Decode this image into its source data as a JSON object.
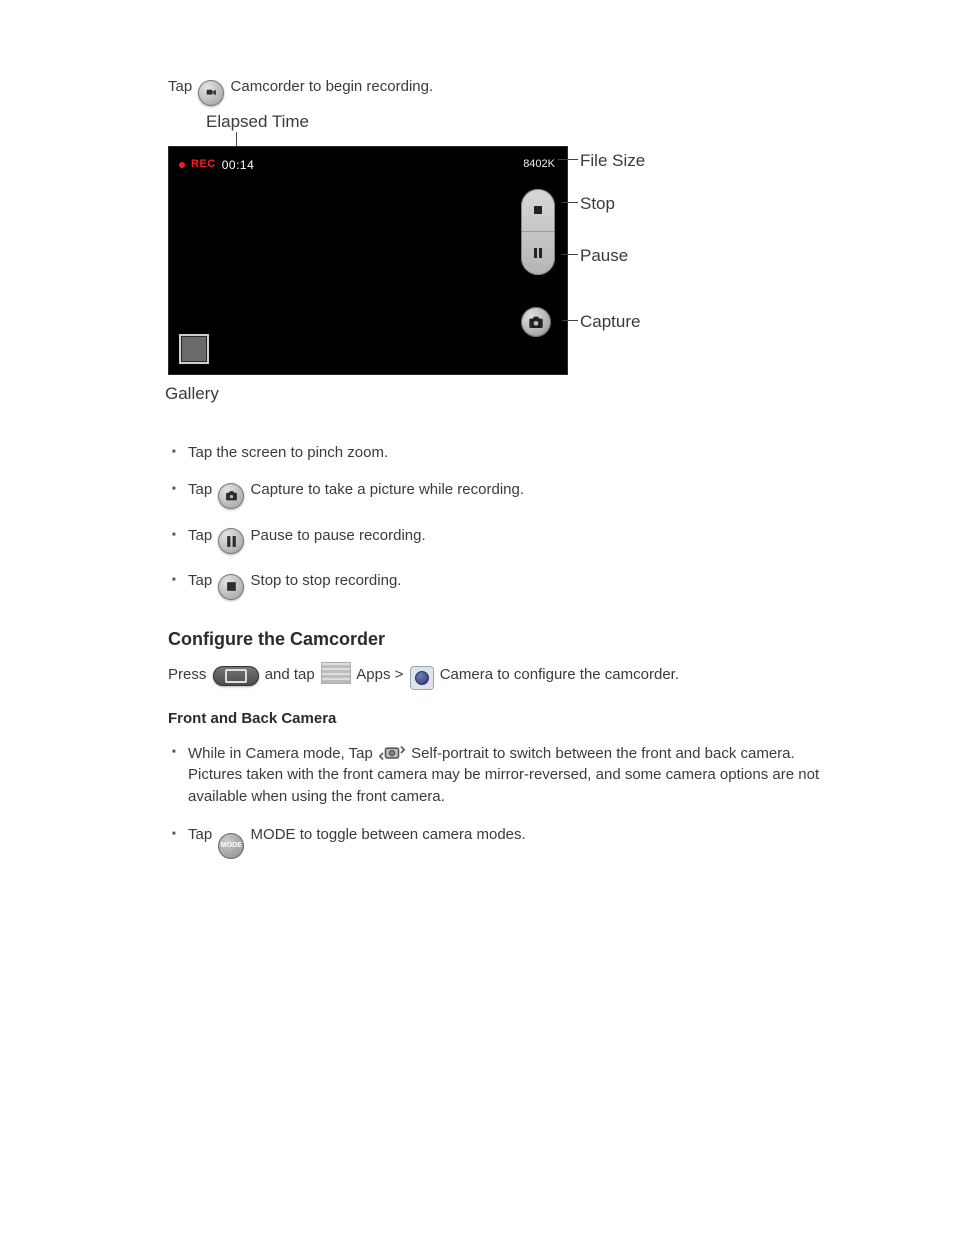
{
  "intro_before": "Tap ",
  "intro_after": " Camcorder to begin recording.",
  "viewfinder": {
    "elapsed_label": "Elapsed Time",
    "rec_text": "REC",
    "rec_time": "00:14",
    "file_size": "8402K",
    "file_size_label": "File Size",
    "stop_label": "Stop",
    "pause_label": "Pause",
    "capture_label": "Capture",
    "gallery_label": "Gallery"
  },
  "bullets_rec": {
    "b1_before": "Tap",
    "b1_mid": "the screen to pinch zoom.",
    "b2_before": "Tap ",
    "b2_after": " Capture to take a picture while recording.",
    "b3_before": "Tap ",
    "b3_after": " Pause to pause recording.",
    "b4_before": "Tap ",
    "b4_after": " Stop to stop recording."
  },
  "section_config": "Configure the Camcorder",
  "config_para_before": "Press ",
  "config_para_mid1": " and tap ",
  "config_para_mid2": " Apps > ",
  "config_para_after": " Camera to configure the camcorder.",
  "front_h": "Front and Back Camera",
  "front_bullets": {
    "b1_before": "While in Camera mode, Tap ",
    "b1_after": " Self-portrait to switch between the front and back camera. Pictures taken with the front camera may be mirror-reversed, and some camera options are not available when using the front camera.",
    "b2_before": "Tap ",
    "b2_after": " MODE to toggle between camera modes."
  }
}
